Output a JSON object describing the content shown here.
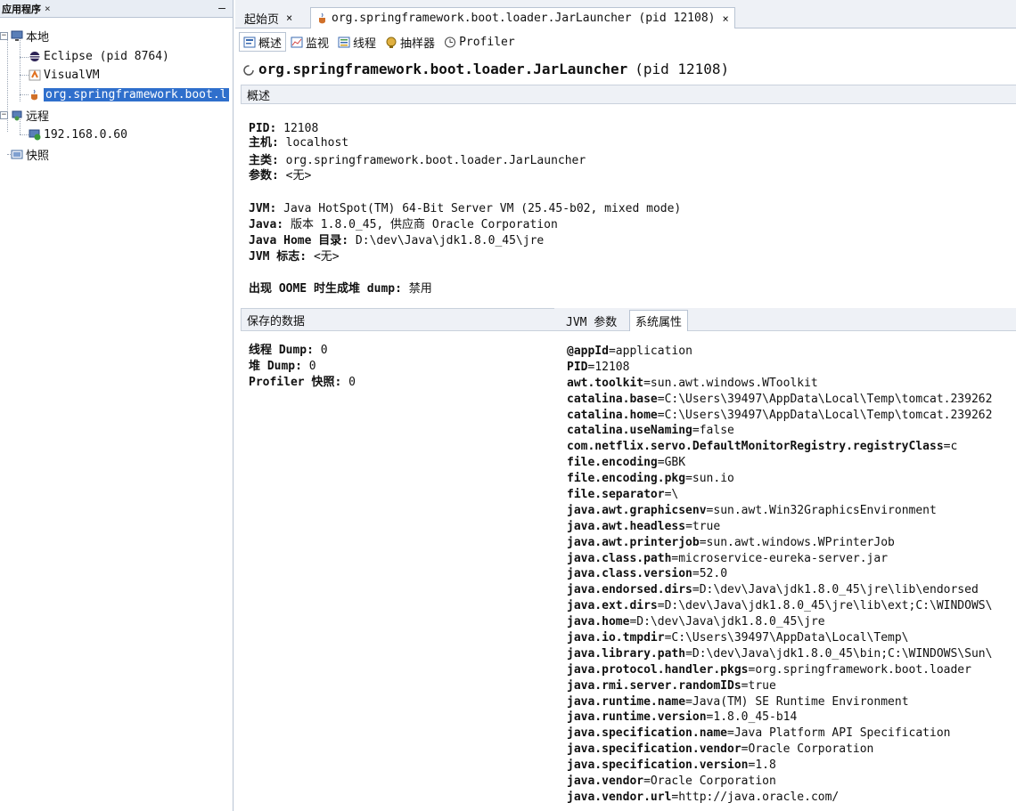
{
  "left_panel": {
    "title": "应用程序",
    "close": "×",
    "minimize": "—",
    "tree": {
      "local": "本地",
      "eclipse": "Eclipse (pid 8764)",
      "visualvm": "VisualVM",
      "jar": "org.springframework.boot.l",
      "remote": "远程",
      "ip": "192.168.0.60",
      "snapshots": "快照"
    }
  },
  "doc_tabs": {
    "start": "起始页",
    "start_close": "×",
    "jar": "org.springframework.boot.loader.JarLauncher (pid 12108)",
    "jar_close": "×"
  },
  "view_tabs": [
    "概述",
    "监视",
    "线程",
    "抽样器",
    "Profiler"
  ],
  "main": {
    "title": "org.springframework.boot.loader.JarLauncher",
    "pid": "(pid 12108)",
    "section": "概述",
    "pid_label": "PID:",
    "pid_value": "12108",
    "host_label": "主机:",
    "host_value": "localhost",
    "mainclass_label": "主类:",
    "mainclass_value": "org.springframework.boot.loader.JarLauncher",
    "args_label": "参数:",
    "args_value": "<无>",
    "jvm_label": "JVM:",
    "jvm_value": "Java HotSpot(TM) 64-Bit Server VM (25.45-b02, mixed mode)",
    "java_label": "Java:",
    "java_value": "版本 1.8.0_45, 供应商 Oracle Corporation",
    "javahome_label": "Java Home 目录:",
    "javahome_value": "D:\\dev\\Java\\jdk1.8.0_45\\jre",
    "jvmflags_label": "JVM 标志:",
    "jvmflags_value": "<无>",
    "oome_label": "出现 OOME 时生成堆 dump:",
    "oome_value": "禁用"
  },
  "saved": {
    "title": "保存的数据",
    "close": "×",
    "thread_label": "线程 Dump:",
    "thread_value": "0",
    "heap_label": "堆 Dump:",
    "heap_value": "0",
    "profiler_label": "Profiler 快照:",
    "profiler_value": "0"
  },
  "prop_tabs": {
    "jvm_args": "JVM 参数",
    "sys_props": "系统属性"
  },
  "properties": [
    {
      "k": "@appId",
      "v": "application"
    },
    {
      "k": "PID",
      "v": "12108"
    },
    {
      "k": "awt.toolkit",
      "v": "sun.awt.windows.WToolkit"
    },
    {
      "k": "catalina.base",
      "v": "C:\\Users\\39497\\AppData\\Local\\Temp\\tomcat.239262"
    },
    {
      "k": "catalina.home",
      "v": "C:\\Users\\39497\\AppData\\Local\\Temp\\tomcat.239262"
    },
    {
      "k": "catalina.useNaming",
      "v": "false"
    },
    {
      "k": "com.netflix.servo.DefaultMonitorRegistry.registryClass",
      "v": "c"
    },
    {
      "k": "file.encoding",
      "v": "GBK"
    },
    {
      "k": "file.encoding.pkg",
      "v": "sun.io"
    },
    {
      "k": "file.separator",
      "v": "\\"
    },
    {
      "k": "java.awt.graphicsenv",
      "v": "sun.awt.Win32GraphicsEnvironment"
    },
    {
      "k": "java.awt.headless",
      "v": "true"
    },
    {
      "k": "java.awt.printerjob",
      "v": "sun.awt.windows.WPrinterJob"
    },
    {
      "k": "java.class.path",
      "v": "microservice-eureka-server.jar"
    },
    {
      "k": "java.class.version",
      "v": "52.0"
    },
    {
      "k": "java.endorsed.dirs",
      "v": "D:\\dev\\Java\\jdk1.8.0_45\\jre\\lib\\endorsed"
    },
    {
      "k": "java.ext.dirs",
      "v": "D:\\dev\\Java\\jdk1.8.0_45\\jre\\lib\\ext;C:\\WINDOWS\\"
    },
    {
      "k": "java.home",
      "v": "D:\\dev\\Java\\jdk1.8.0_45\\jre"
    },
    {
      "k": "java.io.tmpdir",
      "v": "C:\\Users\\39497\\AppData\\Local\\Temp\\"
    },
    {
      "k": "java.library.path",
      "v": "D:\\dev\\Java\\jdk1.8.0_45\\bin;C:\\WINDOWS\\Sun\\"
    },
    {
      "k": "java.protocol.handler.pkgs",
      "v": "org.springframework.boot.loader"
    },
    {
      "k": "java.rmi.server.randomIDs",
      "v": "true"
    },
    {
      "k": "java.runtime.name",
      "v": "Java(TM) SE Runtime Environment"
    },
    {
      "k": "java.runtime.version",
      "v": "1.8.0_45-b14"
    },
    {
      "k": "java.specification.name",
      "v": "Java Platform API Specification"
    },
    {
      "k": "java.specification.vendor",
      "v": "Oracle Corporation"
    },
    {
      "k": "java.specification.version",
      "v": "1.8"
    },
    {
      "k": "java.vendor",
      "v": "Oracle Corporation"
    },
    {
      "k": "java.vendor.url",
      "v": "http://java.oracle.com/"
    }
  ],
  "colors": {
    "selection": "#2f6fcc",
    "panel_bg": "#eef1f6",
    "border": "#b9c4d3"
  },
  "icons": {
    "local": "computer-icon",
    "eclipse": "eclipse-icon",
    "visualvm": "visualvm-icon",
    "jar": "java-cup-icon",
    "remote": "remote-host-icon",
    "ip": "network-host-icon",
    "snapshots": "snapshot-icon"
  }
}
